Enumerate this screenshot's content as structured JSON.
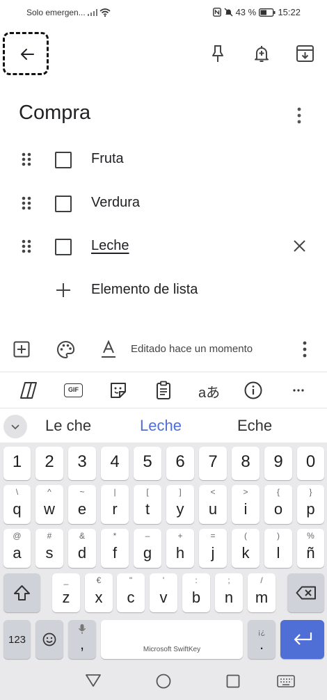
{
  "status_bar": {
    "carrier": "Solo emergen...",
    "battery": "43 %",
    "time": "15:22"
  },
  "note": {
    "title": "Compra",
    "items": [
      {
        "label": "Fruta",
        "checked": false
      },
      {
        "label": "Verdura",
        "checked": false
      },
      {
        "label": "Leche",
        "checked": false,
        "editing": true
      }
    ],
    "add_item_label": "Elemento de lista",
    "edited_text": "Editado hace un momento"
  },
  "keyboard": {
    "toolbar_gif": "GIF",
    "predictions": [
      "Le che",
      "Leche",
      "Eche"
    ],
    "rows": {
      "numbers": [
        "1",
        "2",
        "3",
        "4",
        "5",
        "6",
        "7",
        "8",
        "9",
        "0"
      ],
      "row1": [
        [
          "q",
          "\\"
        ],
        [
          "w",
          "^"
        ],
        [
          "e",
          "~"
        ],
        [
          "r",
          "|"
        ],
        [
          "t",
          "["
        ],
        [
          "y",
          "]"
        ],
        [
          "u",
          "<"
        ],
        [
          "i",
          ">"
        ],
        [
          "o",
          "{"
        ],
        [
          "p",
          "}"
        ]
      ],
      "row2": [
        [
          "a",
          "@"
        ],
        [
          "s",
          "#"
        ],
        [
          "d",
          "&"
        ],
        [
          "f",
          "*"
        ],
        [
          "g",
          "–"
        ],
        [
          "h",
          "+"
        ],
        [
          "j",
          "="
        ],
        [
          "k",
          "("
        ],
        [
          "l",
          ")"
        ],
        [
          "ñ",
          "%"
        ]
      ],
      "row3": [
        [
          "z",
          "_"
        ],
        [
          "x",
          "€"
        ],
        [
          "c",
          "\""
        ],
        [
          "v",
          "'"
        ],
        [
          "b",
          ":"
        ],
        [
          "n",
          ";"
        ],
        [
          "m",
          "/"
        ]
      ]
    },
    "key_123": "123",
    "comma": ",",
    "period": ".",
    "period_sub": "¡¿",
    "space_label": "Microsoft SwiftKey"
  },
  "colors": {
    "accent": "#4f6ed6",
    "prediction_highlight": "#4f6ed6",
    "keyboard_bg": "#e9e9ec"
  }
}
